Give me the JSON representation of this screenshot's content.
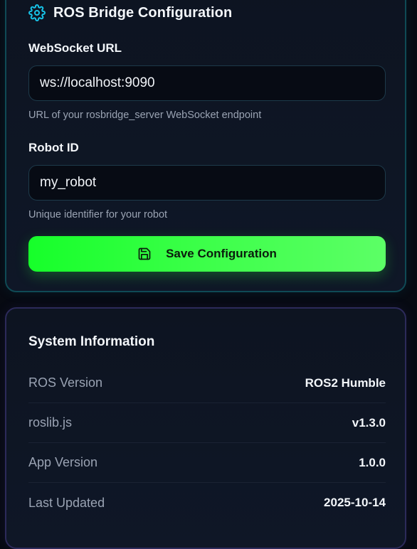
{
  "config_card": {
    "title": "ROS Bridge Configuration",
    "icon": "gear-icon",
    "accent_color": "#17c3e8",
    "websocket": {
      "label": "WebSocket URL",
      "value": "ws://localhost:9090",
      "help": "URL of your rosbridge_server WebSocket endpoint"
    },
    "robot_id": {
      "label": "Robot ID",
      "value": "my_robot",
      "help": "Unique identifier for your robot"
    },
    "save_button": {
      "label": "Save Configuration",
      "icon": "save-icon",
      "color": "#2dff3c"
    }
  },
  "system_info": {
    "title": "System Information",
    "rows": [
      {
        "label": "ROS Version",
        "value": "ROS2 Humble"
      },
      {
        "label": "roslib.js",
        "value": "v1.3.0"
      },
      {
        "label": "App Version",
        "value": "1.0.0"
      },
      {
        "label": "Last Updated",
        "value": "2025-10-14"
      }
    ]
  }
}
